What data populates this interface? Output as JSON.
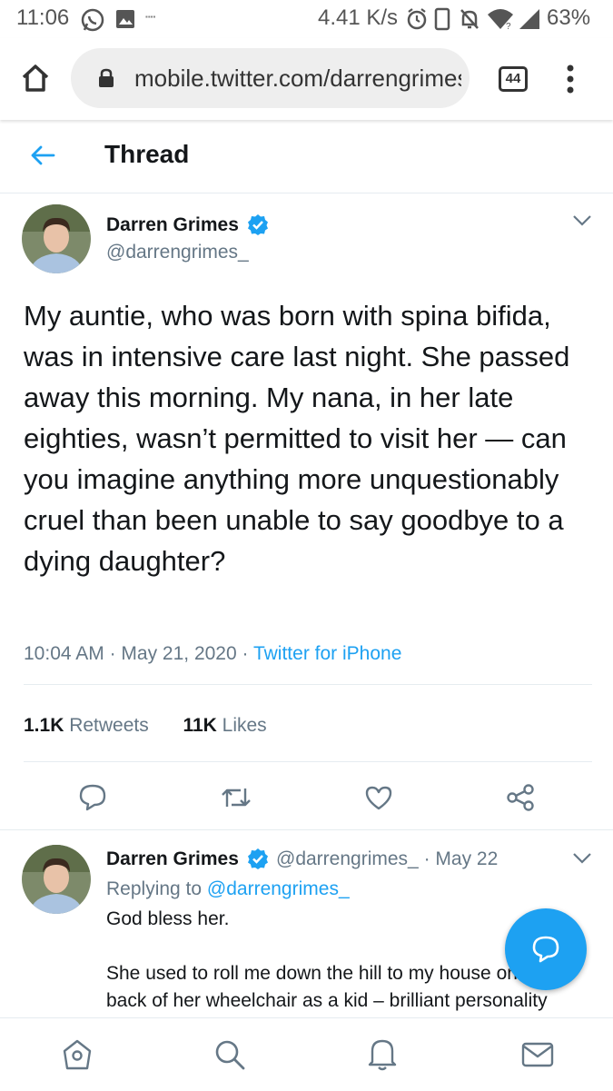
{
  "status_bar": {
    "time": "11:06",
    "network_speed": "4.41 K/s",
    "battery": "63%"
  },
  "browser": {
    "url": "mobile.twitter.com/darrengrimes_",
    "tab_count": "44"
  },
  "header": {
    "title": "Thread"
  },
  "tweet": {
    "author_name": "Darren Grimes",
    "author_handle": "@darrengrimes_",
    "text": "My auntie, who was born with spina bifida, was in intensive care last night. She passed away this morning. My nana, in her late eighties, wasn’t permitted to visit her — can you imagine anything more unquestionably cruel than been unable to say goodbye to a dying daughter?",
    "time": "10:04 AM",
    "date": "May 21, 2020",
    "source": "Twitter for iPhone",
    "retweets_count": "1.1K",
    "retweets_label": "Retweets",
    "likes_count": "11K",
    "likes_label": "Likes"
  },
  "reply": {
    "author_name": "Darren Grimes",
    "author_handle": "@darrengrimes_",
    "separator": "·",
    "date": "May 22",
    "replying_prefix": "Replying to",
    "replying_to": "@darrengrimes_",
    "line1": "God bless her.",
    "line2": "She used to roll me down the hill to my house on the",
    "line3": "back of her wheelchair as a kid – brilliant personality"
  },
  "colors": {
    "accent": "#1da1f2",
    "secondary_text": "#657786",
    "verified": "#1da1f2"
  },
  "icons": {
    "back": "arrow-left-icon",
    "home": "home-icon",
    "search": "search-icon",
    "notifications": "bell-icon",
    "messages": "mail-icon",
    "compose": "compose-bubble-icon"
  }
}
